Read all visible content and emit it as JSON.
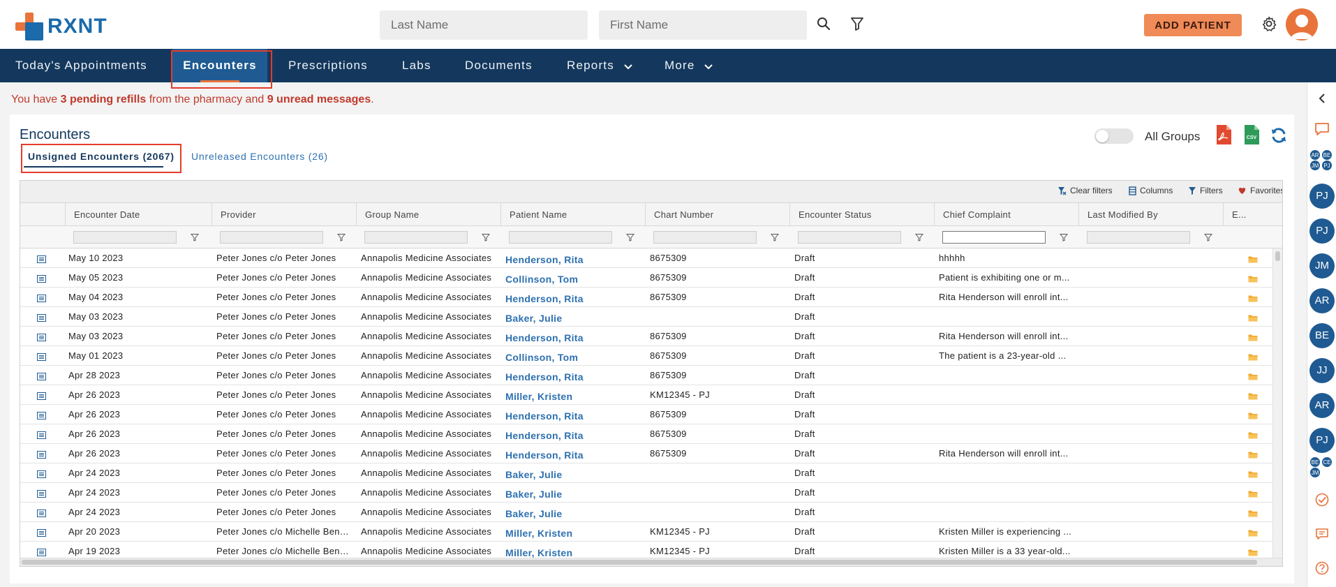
{
  "app": {
    "logo_text": "RXNT"
  },
  "header": {
    "last_name_placeholder": "Last Name",
    "first_name_placeholder": "First Name",
    "add_patient_label": "ADD PATIENT",
    "brand_orange": "#e8743b",
    "brand_blue": "#1b6aab"
  },
  "nav": {
    "items": [
      {
        "label": "Today's Appointments"
      },
      {
        "label": "Encounters",
        "active": true
      },
      {
        "label": "Prescriptions"
      },
      {
        "label": "Labs"
      },
      {
        "label": "Documents"
      },
      {
        "label": "Reports",
        "has_caret": true
      },
      {
        "label": "More",
        "has_caret": true
      }
    ]
  },
  "banner": {
    "part1": "You have ",
    "refills": "3 pending refills",
    "part2": " from the pharmacy and ",
    "messages": "9 unread messages",
    "part3": "."
  },
  "page": {
    "title": "Encounters",
    "tabs": [
      {
        "label": "Unsigned Encounters (2067)",
        "active": true
      },
      {
        "label": "Unreleased Encounters (26)"
      }
    ],
    "all_groups_label": "All Groups",
    "export_pdf_icon": "pdf-icon",
    "export_csv_icon": "csv-icon"
  },
  "toolbar": {
    "clear_filters": "Clear filters",
    "columns": "Columns",
    "filters": "Filters",
    "favorites": "Favorites"
  },
  "grid": {
    "columns": [
      "Encounter Date",
      "Provider",
      "Group Name",
      "Patient Name",
      "Chart Number",
      "Encounter Status",
      "Chief Complaint",
      "Last Modified By",
      "E..."
    ],
    "rows": [
      {
        "date": "May 10 2023",
        "provider": "Peter Jones c/o Peter Jones",
        "group": "Annapolis Medicine Associates",
        "patient": "Henderson, Rita",
        "chart": "8675309",
        "status": "Draft",
        "complaint": "hhhhh",
        "modified": ""
      },
      {
        "date": "May 05 2023",
        "provider": "Peter Jones c/o Peter Jones",
        "group": "Annapolis Medicine Associates",
        "patient": "Collinson, Tom",
        "chart": "8675309",
        "status": "Draft",
        "complaint": "Patient is exhibiting one or m...",
        "modified": ""
      },
      {
        "date": "May 04 2023",
        "provider": "Peter Jones c/o Peter Jones",
        "group": "Annapolis Medicine Associates",
        "patient": "Henderson, Rita",
        "chart": "8675309",
        "status": "Draft",
        "complaint": "Rita Henderson will enroll int...",
        "modified": ""
      },
      {
        "date": "May 03 2023",
        "provider": "Peter Jones c/o Peter Jones",
        "group": "Annapolis Medicine Associates",
        "patient": "Baker, Julie",
        "chart": "",
        "status": "Draft",
        "complaint": "",
        "modified": ""
      },
      {
        "date": "May 03 2023",
        "provider": "Peter Jones c/o Peter Jones",
        "group": "Annapolis Medicine Associates",
        "patient": "Henderson, Rita",
        "chart": "8675309",
        "status": "Draft",
        "complaint": "Rita Henderson will enroll int...",
        "modified": ""
      },
      {
        "date": "May 01 2023",
        "provider": "Peter Jones c/o Peter Jones",
        "group": "Annapolis Medicine Associates",
        "patient": "Collinson, Tom",
        "chart": "8675309",
        "status": "Draft",
        "complaint": "The patient is a 23-year-old ...",
        "modified": ""
      },
      {
        "date": "Apr 28 2023",
        "provider": "Peter Jones c/o Peter Jones",
        "group": "Annapolis Medicine Associates",
        "patient": "Henderson, Rita",
        "chart": "8675309",
        "status": "Draft",
        "complaint": "",
        "modified": ""
      },
      {
        "date": "Apr 26 2023",
        "provider": "Peter Jones c/o Peter Jones",
        "group": "Annapolis Medicine Associates",
        "patient": "Miller, Kristen",
        "chart": "KM12345 - PJ",
        "status": "Draft",
        "complaint": "",
        "modified": ""
      },
      {
        "date": "Apr 26 2023",
        "provider": "Peter Jones c/o Peter Jones",
        "group": "Annapolis Medicine Associates",
        "patient": "Henderson, Rita",
        "chart": "8675309",
        "status": "Draft",
        "complaint": "",
        "modified": ""
      },
      {
        "date": "Apr 26 2023",
        "provider": "Peter Jones c/o Peter Jones",
        "group": "Annapolis Medicine Associates",
        "patient": "Henderson, Rita",
        "chart": "8675309",
        "status": "Draft",
        "complaint": "",
        "modified": ""
      },
      {
        "date": "Apr 26 2023",
        "provider": "Peter Jones c/o Peter Jones",
        "group": "Annapolis Medicine Associates",
        "patient": "Henderson, Rita",
        "chart": "8675309",
        "status": "Draft",
        "complaint": "Rita Henderson will enroll int...",
        "modified": ""
      },
      {
        "date": "Apr 24 2023",
        "provider": "Peter Jones c/o Peter Jones",
        "group": "Annapolis Medicine Associates",
        "patient": "Baker, Julie",
        "chart": "",
        "status": "Draft",
        "complaint": "",
        "modified": ""
      },
      {
        "date": "Apr 24 2023",
        "provider": "Peter Jones c/o Peter Jones",
        "group": "Annapolis Medicine Associates",
        "patient": "Baker, Julie",
        "chart": "",
        "status": "Draft",
        "complaint": "",
        "modified": ""
      },
      {
        "date": "Apr 24 2023",
        "provider": "Peter Jones c/o Peter Jones",
        "group": "Annapolis Medicine Associates",
        "patient": "Baker, Julie",
        "chart": "",
        "status": "Draft",
        "complaint": "",
        "modified": ""
      },
      {
        "date": "Apr 20 2023",
        "provider": "Peter Jones c/o Michelle Benn...",
        "group": "Annapolis Medicine Associates",
        "patient": "Miller, Kristen",
        "chart": "KM12345 - PJ",
        "status": "Draft",
        "complaint": "Kristen Miller is experiencing ...",
        "modified": ""
      },
      {
        "date": "Apr 19 2023",
        "provider": "Peter Jones c/o Michelle Benn...",
        "group": "Annapolis Medicine Associates",
        "patient": "Miller, Kristen",
        "chart": "KM12345 - PJ",
        "status": "Draft",
        "complaint": "Kristen Miller is a 33 year-old...",
        "modified": ""
      }
    ]
  },
  "rail": {
    "group_avatars_1": [
      "AR",
      "BE",
      "JM",
      "PJ"
    ],
    "avatars": [
      "PJ",
      "PJ",
      "JM",
      "AR",
      "BE",
      "JJ",
      "AR",
      "PJ"
    ],
    "group_avatars_2": [
      "BE",
      "CE",
      "JM"
    ]
  }
}
